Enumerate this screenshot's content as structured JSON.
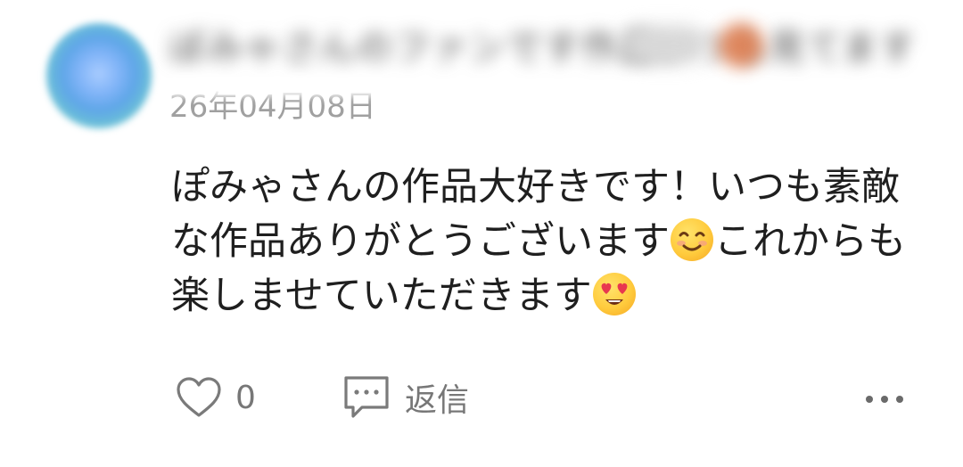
{
  "comment": {
    "username": "ぽみゃさんのファンです作品いつも見てます",
    "date": "26年04月08日",
    "body_lines": [
      {
        "text": "ぽみゃさんの作品大好きです！いつも素敵",
        "emoji": ""
      },
      {
        "text": "な作品ありがとうございます",
        "emoji": "smiling-face-icon",
        "after": "これからも"
      },
      {
        "text": "楽しませていただきます",
        "emoji": "heart-eyes-face-icon",
        "after": ""
      }
    ],
    "actions": {
      "like_icon": "heart-outline-icon",
      "like_count": "0",
      "reply_icon": "speech-bubble-icon",
      "reply_label": "返信",
      "more_icon": "more-horizontal-icon"
    }
  },
  "colors": {
    "text": "#1f1f1f",
    "muted": "#777777",
    "date": "#a0a0a0"
  }
}
